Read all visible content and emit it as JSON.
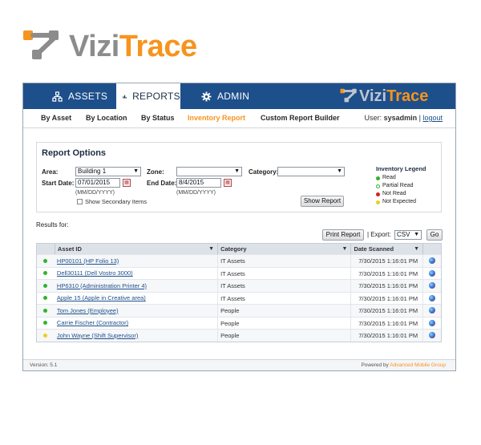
{
  "brand": {
    "part1": "Vizi",
    "part2": "Trace",
    "accent": "#f7941d",
    "gray": "#8c8c8c",
    "navy": "#1d4f8b"
  },
  "topnav": {
    "tabs": [
      {
        "label": "ASSETS",
        "icon": "network-icon"
      },
      {
        "label": "REPORTS",
        "icon": "bar-chart-icon",
        "active": true
      },
      {
        "label": "ADMIN",
        "icon": "gear-icon"
      }
    ]
  },
  "subnav": {
    "items": [
      "By Asset",
      "By Location",
      "By Status",
      "Inventory Report",
      "Custom Report Builder"
    ],
    "active": "Inventory Report",
    "user_label": "User:",
    "user_name": "sysadmin",
    "separator": "|",
    "logout": "logout"
  },
  "options": {
    "title": "Report Options",
    "area_label": "Area:",
    "area_value": "Building 1",
    "zone_label": "Zone:",
    "zone_value": "",
    "category_label": "Category:",
    "category_value": "",
    "start_label": "Start Date:",
    "start_value": "07/01/2015",
    "end_label": "End Date:",
    "end_value": "8/4/2015",
    "date_hint": "(MM/DD/YYYY)",
    "secondary_label": "Show Secondary Items",
    "show_report": "Show Report"
  },
  "legend": {
    "title": "Inventory Legend",
    "items": [
      {
        "label": "Read",
        "color": "#2db52d"
      },
      {
        "label": "Partial Read",
        "color": "#2db52d",
        "hollow": true
      },
      {
        "label": "Not Read",
        "color": "#d42020"
      },
      {
        "label": "Not Expected",
        "color": "#e8d21a"
      }
    ]
  },
  "results": {
    "label": "Results for:",
    "print": "Print Report",
    "export_label": "| Export:",
    "export_value": "CSV",
    "go": "Go"
  },
  "table": {
    "headers": [
      "Asset ID",
      "Category",
      "Date Scanned"
    ],
    "rows": [
      {
        "asset": "HP00101 (HP Folio 13)",
        "category": "IT Assets",
        "date": "7/30/2015 1:16:01 PM",
        "status": "#2db52d"
      },
      {
        "asset": "Dell30111 (Dell Vostro 3000)",
        "category": "IT Assets",
        "date": "7/30/2015 1:16:01 PM",
        "status": "#2db52d"
      },
      {
        "asset": "HP6310 (Administration Printer 4)",
        "category": "IT Assets",
        "date": "7/30/2015 1:16:01 PM",
        "status": "#2db52d"
      },
      {
        "asset": "Apple 15 (Apple in Creative area)",
        "category": "IT Assets",
        "date": "7/30/2015 1:16:01 PM",
        "status": "#2db52d"
      },
      {
        "asset": "Tom Jones (Employee)",
        "category": "People",
        "date": "7/30/2015 1:16:01 PM",
        "status": "#2db52d"
      },
      {
        "asset": "Carrie Fischer (Contractor)",
        "category": "People",
        "date": "7/30/2015 1:16:01 PM",
        "status": "#2db52d"
      },
      {
        "asset": "John Wayne (Shift Supervisor)",
        "category": "People",
        "date": "7/30/2015 1:16:01 PM",
        "status": "#e8d21a"
      }
    ]
  },
  "footer": {
    "version": "Version: 5.1",
    "powered": "Powered by",
    "company": "Advanced Mobile Group"
  }
}
